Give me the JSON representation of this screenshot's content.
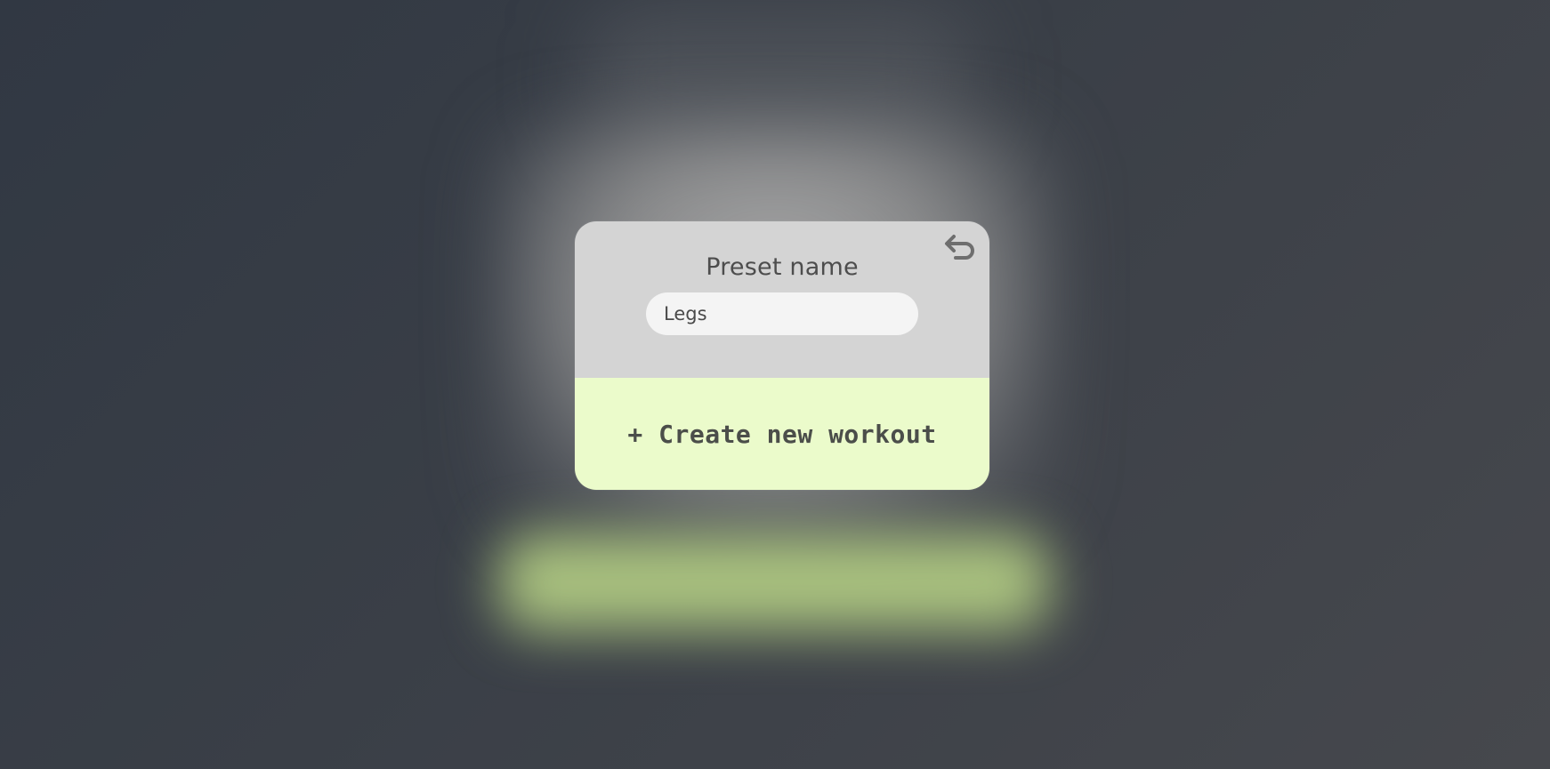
{
  "preset": {
    "label": "Preset name",
    "value": "Legs",
    "back_icon": "return-arrow-icon"
  },
  "actions": {
    "create_label": "+ Create new workout"
  },
  "colors": {
    "card_top": "#d4d4d4",
    "input_bg": "#f4f4f4",
    "create_bg": "#ebfbcb",
    "text": "#4d4d4d",
    "icon": "#6e6e6e"
  }
}
